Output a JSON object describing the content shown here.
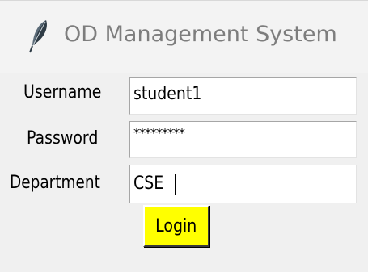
{
  "window": {
    "title": "OD Management System",
    "app_icon": "feather-icon"
  },
  "form": {
    "username_label": "Username",
    "username_value": "student1",
    "password_label": "Password",
    "password_value": "*********",
    "department_label": "Department",
    "department_value": "CSE",
    "login_label": "Login"
  },
  "colors": {
    "window_bg": "#f0f0f0",
    "title_text": "#7d7d7d",
    "button_bg": "#ffff00",
    "field_bg": "#ffffff"
  }
}
